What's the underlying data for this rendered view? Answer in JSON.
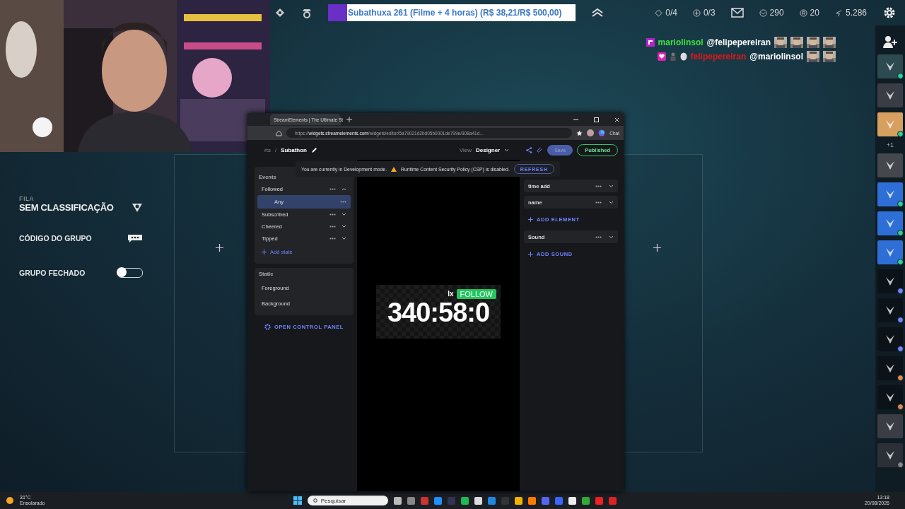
{
  "client_bar": {
    "notification": {
      "text": "Subathuxa 261 (Filme + 4 horas) (R$ 38,21/R$ 500,00)",
      "level": 0.076
    },
    "counters": [
      {
        "kind": "ward",
        "text": "0/4"
      },
      {
        "kind": "plus",
        "text": "0/3"
      },
      {
        "kind": "valor",
        "text": "290"
      },
      {
        "kind": "riot",
        "text": "20"
      },
      {
        "kind": "essence",
        "text": "5.286"
      }
    ]
  },
  "chat": [
    {
      "badges": [
        {
          "kind": "sub"
        }
      ],
      "name": "mariolinsol",
      "color": "#3ee03e",
      "message": "@felipepereiran",
      "emotes": [
        {
          "kind": "picture"
        },
        {
          "kind": "picture"
        },
        {
          "kind": "picture"
        },
        {
          "kind": "picture"
        }
      ]
    },
    {
      "badges": [
        {
          "kind": "heart"
        },
        {
          "kind": "figure"
        },
        {
          "kind": "mask"
        }
      ],
      "name": "felipepereiran",
      "color": "#e01818",
      "message": "@mariolinsol",
      "emotes": [
        {
          "kind": "picture"
        },
        {
          "kind": "picture"
        }
      ]
    }
  ],
  "lobby": {
    "queue_label": "FILA",
    "queue": "SEM CLASSIFICAÇÃO",
    "group_code": "CÓDIGO DO GRUPO",
    "closed_group": {
      "label": "GRUPO FECHADO",
      "on": false
    }
  },
  "friends": {
    "overflow": "+1"
  },
  "browser": {
    "tab": "StreamElements | The Ultimate St",
    "url": "https://**widgets.streamelements.com**/widgets/editor/5a79021d2bd05b0001de799e/308a41d...",
    "copilot": "Chat"
  },
  "editor": {
    "breadcrumb": "rts",
    "separator": "/",
    "title": "Subathon",
    "view_label": "View",
    "view": "Designer",
    "save": "Save",
    "status": "Published",
    "banner": {
      "message": "You are currently in Development mode.",
      "warning": "Runtime Content Security Policy (CSP) is disabled.",
      "action": "REFRESH"
    },
    "events_label": "Events",
    "events": [
      {
        "label": "Followed",
        "expanded": true,
        "children": [
          {
            "label": "Any",
            "selected": true
          }
        ]
      },
      {
        "label": "Subscribed",
        "expanded": false
      },
      {
        "label": "Cheered",
        "expanded": false
      },
      {
        "label": "Tipped",
        "expanded": false
      }
    ],
    "add_state": "Add state",
    "static_label": "Static",
    "static": [
      {
        "label": "Foreground"
      },
      {
        "label": "Background"
      }
    ],
    "control_panel": "OPEN CONTROL PANEL",
    "elements": [
      {
        "label": "time add"
      },
      {
        "label": "name"
      }
    ],
    "add_element": "ADD ELEMENT",
    "sounds": [
      {
        "label": "Sound"
      }
    ],
    "add_sound": "ADD SOUND",
    "preview": {
      "prefix": "lx",
      "event": "FOLLOW",
      "timer": "340:58:0"
    }
  },
  "taskbar": {
    "temp": "31°C",
    "weather": "Ensolarado",
    "search": "Pesquisar",
    "time": "13:18",
    "date": "20/08/2026"
  }
}
